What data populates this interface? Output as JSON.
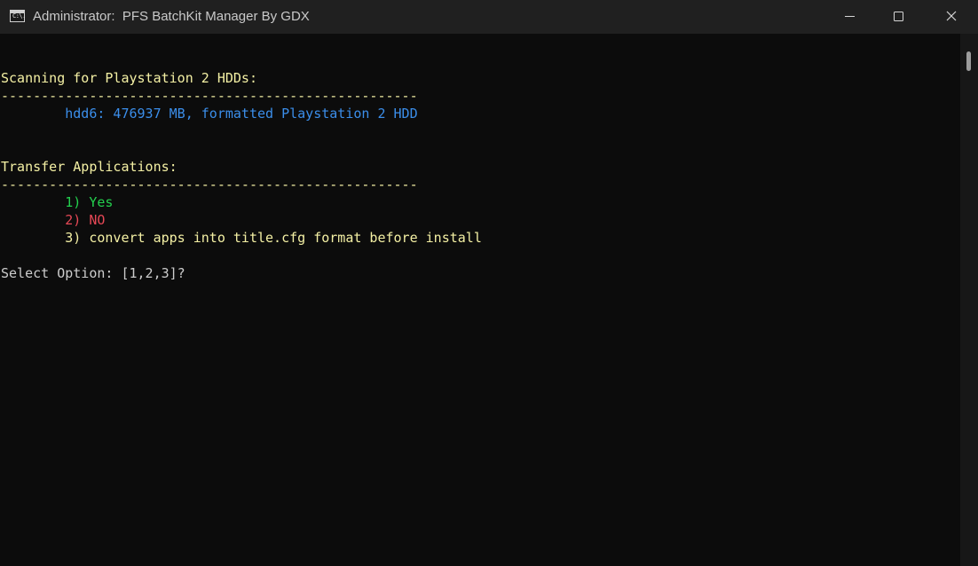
{
  "window": {
    "title": "Administrator:  PFS BatchKit Manager By GDX",
    "icon_text": "C:\\."
  },
  "console": {
    "scan_heading": "Scanning for Playstation 2 HDDs:",
    "separator_1": "----------------------------------------------------",
    "hdd_entry": "        hdd6: 476937 MB, formatted Playstation 2 HDD",
    "transfer_heading": "Transfer Applications:",
    "separator_2": "----------------------------------------------------",
    "options": [
      {
        "label": "        1) Yes"
      },
      {
        "label": "        2) NO"
      },
      {
        "label": "        3) convert apps into title.cfg format before install"
      }
    ],
    "prompt": "Select Option: [1,2,3]?"
  },
  "colors": {
    "background": "#0c0c0c",
    "titlebar": "#202020",
    "yellow": "#f4f0a4",
    "blue": "#3b8eea",
    "green": "#23d14e",
    "red": "#e74856",
    "white": "#cccccc"
  },
  "icons": {
    "app": "console-window-icon",
    "minimize": "minimize-icon",
    "maximize": "maximize-icon",
    "close": "close-icon"
  }
}
